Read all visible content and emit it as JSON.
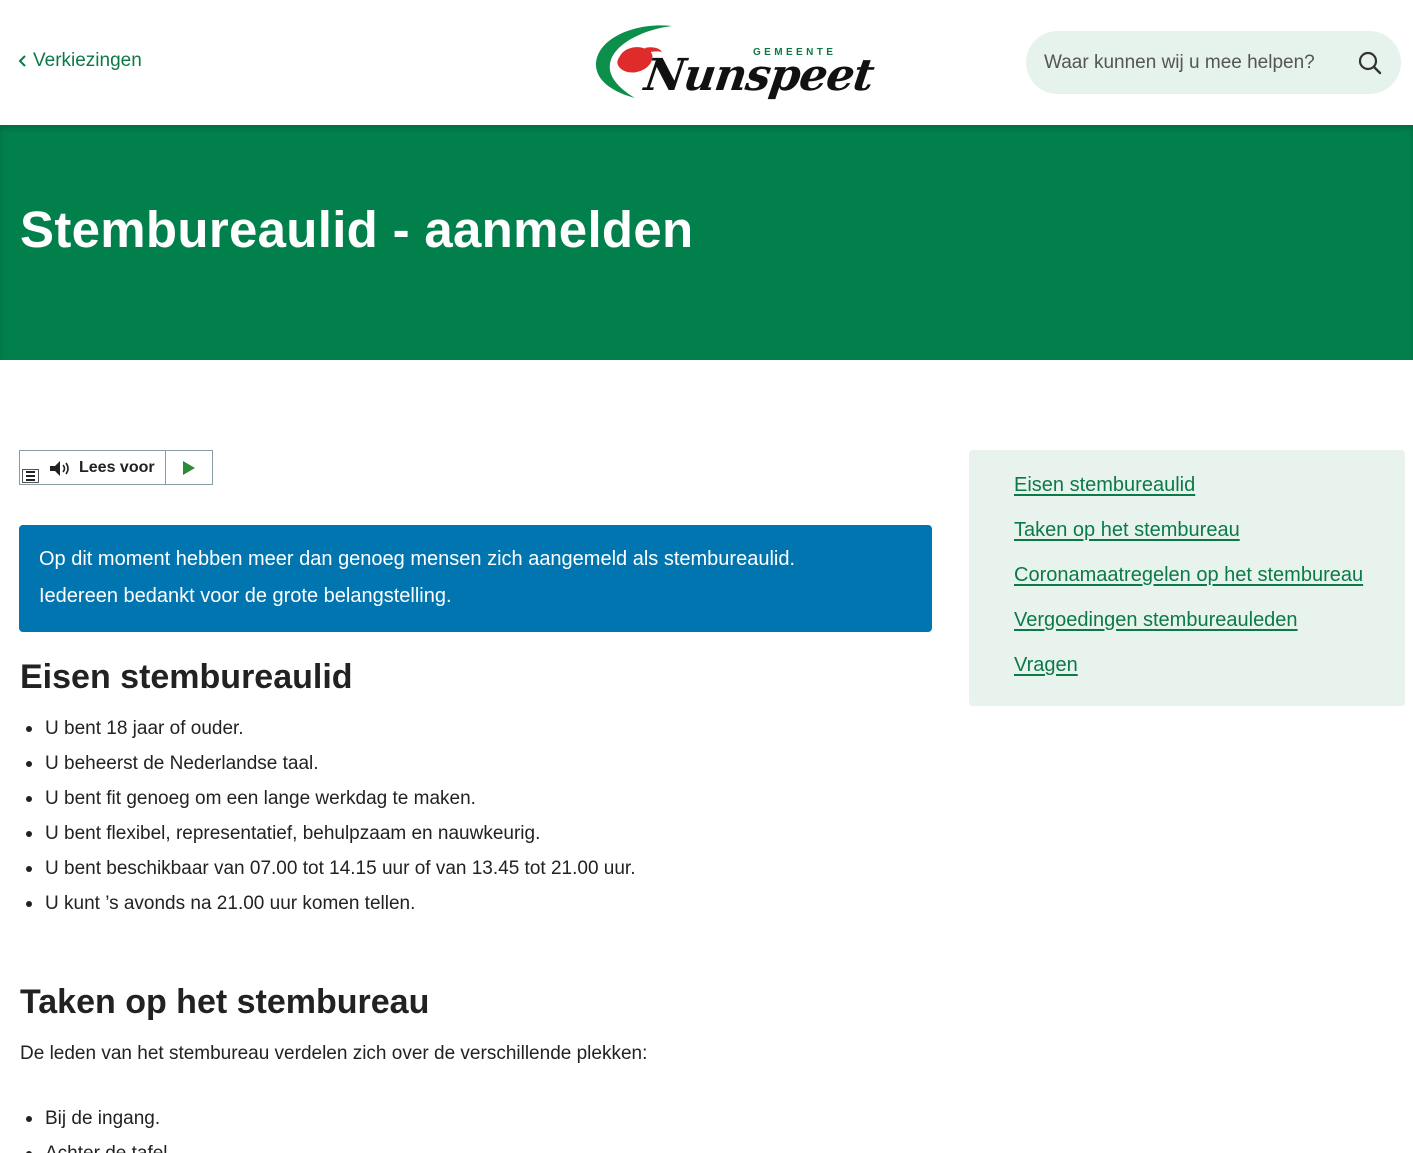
{
  "header": {
    "back_link": "Verkiezingen",
    "logo_small": "GEMEENTE",
    "logo_word": "Nunspeet",
    "search_placeholder": "Waar kunnen wij u mee helpen?"
  },
  "hero": {
    "title": "Stembureaulid - aanmelden"
  },
  "read_aloud": {
    "label": "Lees voor"
  },
  "notice": {
    "line1": "Op dit moment hebben meer dan genoeg mensen zich aangemeld als stembureaulid.",
    "line2": "Iedereen bedankt voor de grote belangstelling."
  },
  "sections": {
    "requirements": {
      "heading": "Eisen stembureaulid",
      "items": [
        "U bent 18 jaar of ouder.",
        "U beheerst de Nederlandse taal.",
        "U bent fit genoeg om een lange werkdag te maken.",
        "U bent flexibel, representatief, behulpzaam en nauwkeurig.",
        "U bent beschikbaar van 07.00 tot 14.15 uur of van 13.45 tot 21.00 uur.",
        "U kunt ’s avonds na 21.00 uur komen tellen."
      ]
    },
    "tasks": {
      "heading": "Taken op het stembureau",
      "intro": "De leden van het stembureau verdelen zich over de verschillende plekken:",
      "items": [
        "Bij de ingang.",
        "Achter de tafel."
      ]
    }
  },
  "toc": {
    "items": [
      "Eisen stembureaulid",
      "Taken op het stembureau",
      "Coronamaatregelen op het stembureau",
      "Vergoedingen stembureauleden",
      "Vragen"
    ]
  },
  "colors": {
    "brand_green": "#02804c",
    "link_green": "#0b7a47",
    "notice_blue": "#0075b0",
    "toc_bg": "#e9f3ee",
    "search_bg": "#e6f2ec",
    "logo_red": "#e02b2b"
  }
}
